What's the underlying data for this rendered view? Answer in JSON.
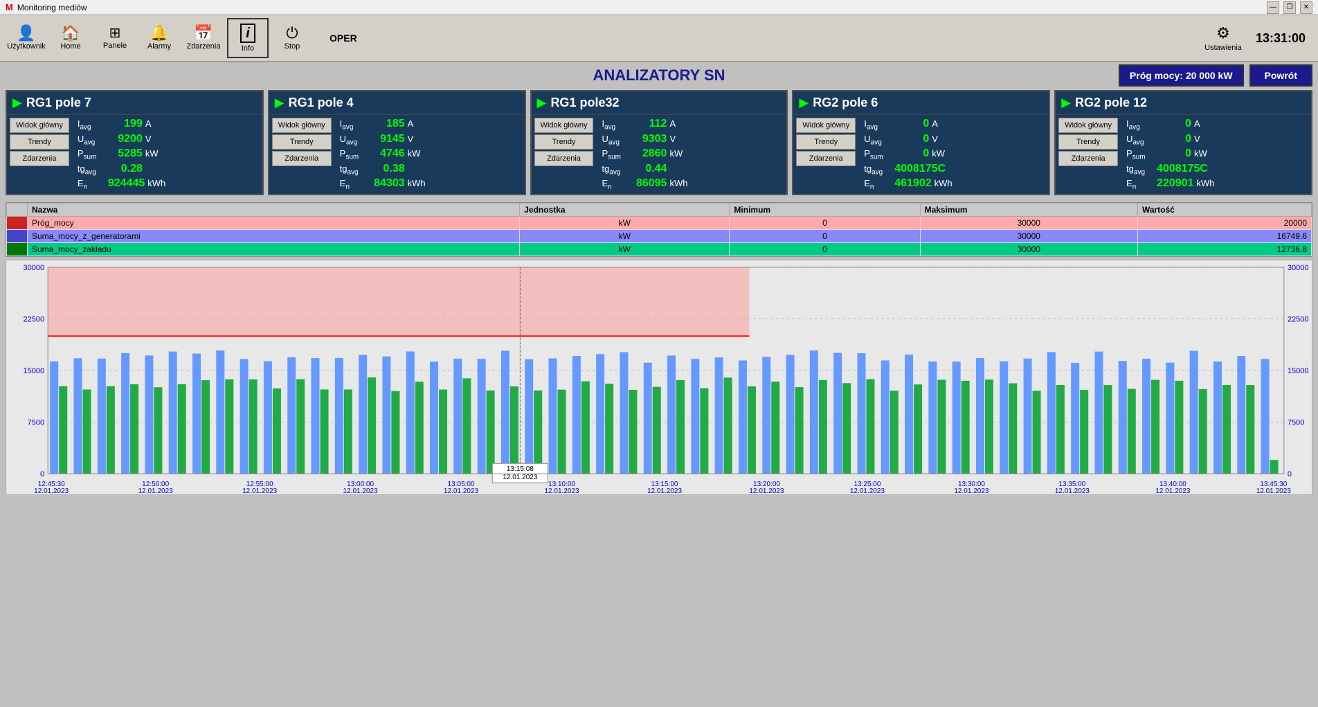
{
  "titleBar": {
    "title": "Monitoring mediów",
    "minimize": "—",
    "restore": "❐",
    "close": "✕"
  },
  "toolbar": {
    "buttons": [
      {
        "id": "uzytkownik",
        "label": "Użytkownik",
        "icon": "👤"
      },
      {
        "id": "home",
        "label": "Home",
        "icon": "🏠"
      },
      {
        "id": "panele",
        "label": "Panele",
        "icon": "⊞"
      },
      {
        "id": "alarmy",
        "label": "Alarmy",
        "icon": "🔔"
      },
      {
        "id": "zdarzenia",
        "label": "Zdarzenia",
        "icon": "📅"
      },
      {
        "id": "info",
        "label": "Info",
        "icon": "ℹ",
        "active": true
      },
      {
        "id": "stop",
        "label": "Stop",
        "icon": "⏻"
      }
    ],
    "operLabel": "OPER",
    "settings": {
      "label": "Ustawienia",
      "icon": "⚙"
    },
    "time": "13:31:00"
  },
  "pageTitle": "ANALIZATORY SN",
  "progMocy": "Próg mocy:  20 000 kW",
  "powrotLabel": "Powrót",
  "analyzers": [
    {
      "id": "rg1p7",
      "title": "RG1 pole 7",
      "active": true,
      "buttons": [
        "Widok główny",
        "Trendy",
        "Zdarzenia"
      ],
      "metrics": [
        {
          "label": "I",
          "sub": "avg",
          "value": "199",
          "unit": "A"
        },
        {
          "label": "U",
          "sub": "avg",
          "value": "9200",
          "unit": "V"
        },
        {
          "label": "P",
          "sub": "sum",
          "value": "5285",
          "unit": "kW"
        },
        {
          "label": "tg",
          "sub": "avg",
          "value": "0.28",
          "unit": ""
        },
        {
          "label": "E",
          "sub": "n",
          "value": "924445",
          "unit": "kWh"
        }
      ]
    },
    {
      "id": "rg1p4",
      "title": "RG1 pole 4",
      "active": true,
      "buttons": [
        "Widok główny",
        "Trendy",
        "Zdarzenia"
      ],
      "metrics": [
        {
          "label": "I",
          "sub": "avg",
          "value": "185",
          "unit": "A"
        },
        {
          "label": "U",
          "sub": "avg",
          "value": "9145",
          "unit": "V"
        },
        {
          "label": "P",
          "sub": "sum",
          "value": "4746",
          "unit": "kW"
        },
        {
          "label": "tg",
          "sub": "avg",
          "value": "0.38",
          "unit": ""
        },
        {
          "label": "E",
          "sub": "n",
          "value": "84303",
          "unit": "kWh"
        }
      ]
    },
    {
      "id": "rg1p32",
      "title": "RG1 pole32",
      "active": true,
      "buttons": [
        "Widok główny",
        "Trendy",
        "Zdarzenia"
      ],
      "metrics": [
        {
          "label": "I",
          "sub": "avg",
          "value": "112",
          "unit": "A"
        },
        {
          "label": "U",
          "sub": "avg",
          "value": "9303",
          "unit": "V"
        },
        {
          "label": "P",
          "sub": "sum",
          "value": "2860",
          "unit": "kW"
        },
        {
          "label": "tg",
          "sub": "avg",
          "value": "0.44",
          "unit": ""
        },
        {
          "label": "E",
          "sub": "n",
          "value": "86095",
          "unit": "kWh"
        }
      ]
    },
    {
      "id": "rg2p6",
      "title": "RG2 pole 6",
      "active": true,
      "buttons": [
        "Widok główny",
        "Trendy",
        "Zdarzenia"
      ],
      "metrics": [
        {
          "label": "I",
          "sub": "avg",
          "value": "0",
          "unit": "A"
        },
        {
          "label": "U",
          "sub": "avg",
          "value": "0",
          "unit": "V"
        },
        {
          "label": "P",
          "sub": "sum",
          "value": "0",
          "unit": "kW"
        },
        {
          "label": "tg",
          "sub": "avg",
          "value": "4008175C",
          "unit": ""
        },
        {
          "label": "E",
          "sub": "n",
          "value": "461902",
          "unit": "kWh"
        }
      ]
    },
    {
      "id": "rg2p12",
      "title": "RG2 pole 12",
      "active": true,
      "buttons": [
        "Widok główny",
        "Trendy",
        "Zdarzenia"
      ],
      "metrics": [
        {
          "label": "I",
          "sub": "avg",
          "value": "0",
          "unit": "A"
        },
        {
          "label": "U",
          "sub": "avg",
          "value": "0",
          "unit": "V"
        },
        {
          "label": "P",
          "sub": "sum",
          "value": "0",
          "unit": "kW"
        },
        {
          "label": "tg",
          "sub": "avg",
          "value": "4008175C",
          "unit": ""
        },
        {
          "label": "E",
          "sub": "n",
          "value": "220901",
          "unit": "kWh"
        }
      ]
    }
  ],
  "table": {
    "headers": [
      "",
      "Nazwa",
      "Jednostka",
      "Minimum",
      "Maksimum",
      "Wartość"
    ],
    "rows": [
      {
        "color": "red",
        "name": "Próg_mocy",
        "unit": "kW",
        "min": "0",
        "max": "30000",
        "value": "20000"
      },
      {
        "color": "blue",
        "name": "Suma_mocy_z_generatorami",
        "unit": "kW",
        "min": "0",
        "max": "30000",
        "value": "16749.6"
      },
      {
        "color": "green",
        "name": "Suma_mocy_zakładu",
        "unit": "kW",
        "min": "0",
        "max": "30000",
        "value": "12736.8"
      }
    ]
  },
  "chart": {
    "yLabels": [
      "0",
      "7500",
      "15000",
      "22500",
      "30000"
    ],
    "xLabels": [
      {
        "time": "12:45:30",
        "date": "12.01.2023"
      },
      {
        "time": "12:50:00",
        "date": "12.01.2023"
      },
      {
        "time": "12:55:00",
        "date": "12.01.2023"
      },
      {
        "time": "13:00:00",
        "date": "12.01.2023"
      },
      {
        "time": "13:05:00",
        "date": "12.01.2023"
      },
      {
        "time": "13:10:00",
        "date": "12.01.2023"
      },
      {
        "time": "13:15:00",
        "date": "12.01.2023"
      },
      {
        "time": "13:20:00",
        "date": "12.01.2023"
      },
      {
        "time": "13:25:00",
        "date": "12.01.2023"
      },
      {
        "time": "13:30:00",
        "date": "12.01.2023"
      },
      {
        "time": "13:35:00",
        "date": "12.01.2023"
      },
      {
        "time": "13:40:00",
        "date": "12.01.2023"
      },
      {
        "time": "13:45:30",
        "date": "12.01.2023"
      }
    ],
    "threshold": 20000,
    "maxY": 30000,
    "crosshairTime": "13:15:08\n12.01.2023"
  }
}
